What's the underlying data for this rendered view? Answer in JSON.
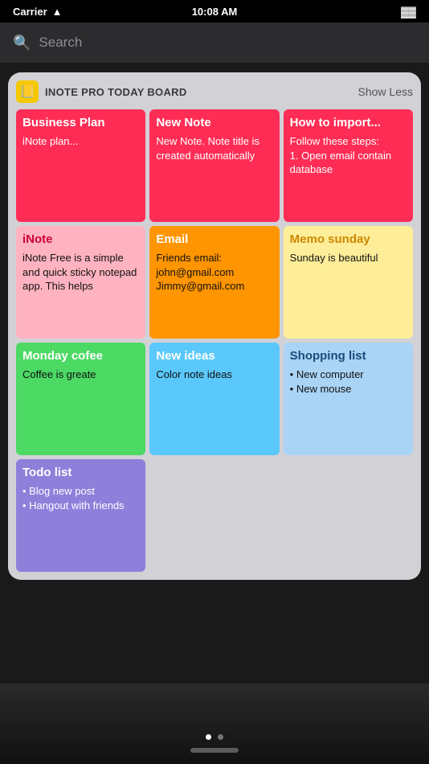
{
  "status": {
    "carrier": "Carrier",
    "wifi": "wifi",
    "time": "10:08 AM",
    "battery": "battery"
  },
  "search": {
    "placeholder": "Search"
  },
  "widget": {
    "icon": "📒",
    "title": "INOTE PRO TODAY BOARD",
    "show_less": "Show Less"
  },
  "notes": [
    {
      "id": "business-plan",
      "color": "pink",
      "title": "Business Plan",
      "body": "iNote plan..."
    },
    {
      "id": "new-note",
      "color": "pink",
      "title": "New Note",
      "body": "New Note. Note title is created automatically"
    },
    {
      "id": "how-to-import",
      "color": "pink",
      "title": "How to import...",
      "body": "Follow these steps:\n1. Open email contain database"
    },
    {
      "id": "inote",
      "color": "light-pink",
      "title": "iNote",
      "body": "iNote Free is a simple and quick sticky notepad app. This helps"
    },
    {
      "id": "email",
      "color": "orange",
      "title": "Email",
      "body": "Friends email: john@gmail.com Jimmy@gmail.com"
    },
    {
      "id": "memo-sunday",
      "color": "yellow",
      "title": "Memo sunday",
      "body": "Sunday is beautiful"
    },
    {
      "id": "monday-cofee",
      "color": "green",
      "title": "Monday cofee",
      "body": "Coffee is greate"
    },
    {
      "id": "new-ideas",
      "color": "blue2",
      "title": "New ideas",
      "body": "Color note ideas"
    },
    {
      "id": "shopping-list",
      "color": "blue",
      "title": "Shopping list",
      "body": "• New computer\n• New mouse"
    },
    {
      "id": "todo-list",
      "color": "purple",
      "title": "Todo list",
      "body": "• Blog new post\n• Hangout with friends"
    }
  ],
  "page_dots": [
    "active",
    "inactive"
  ]
}
